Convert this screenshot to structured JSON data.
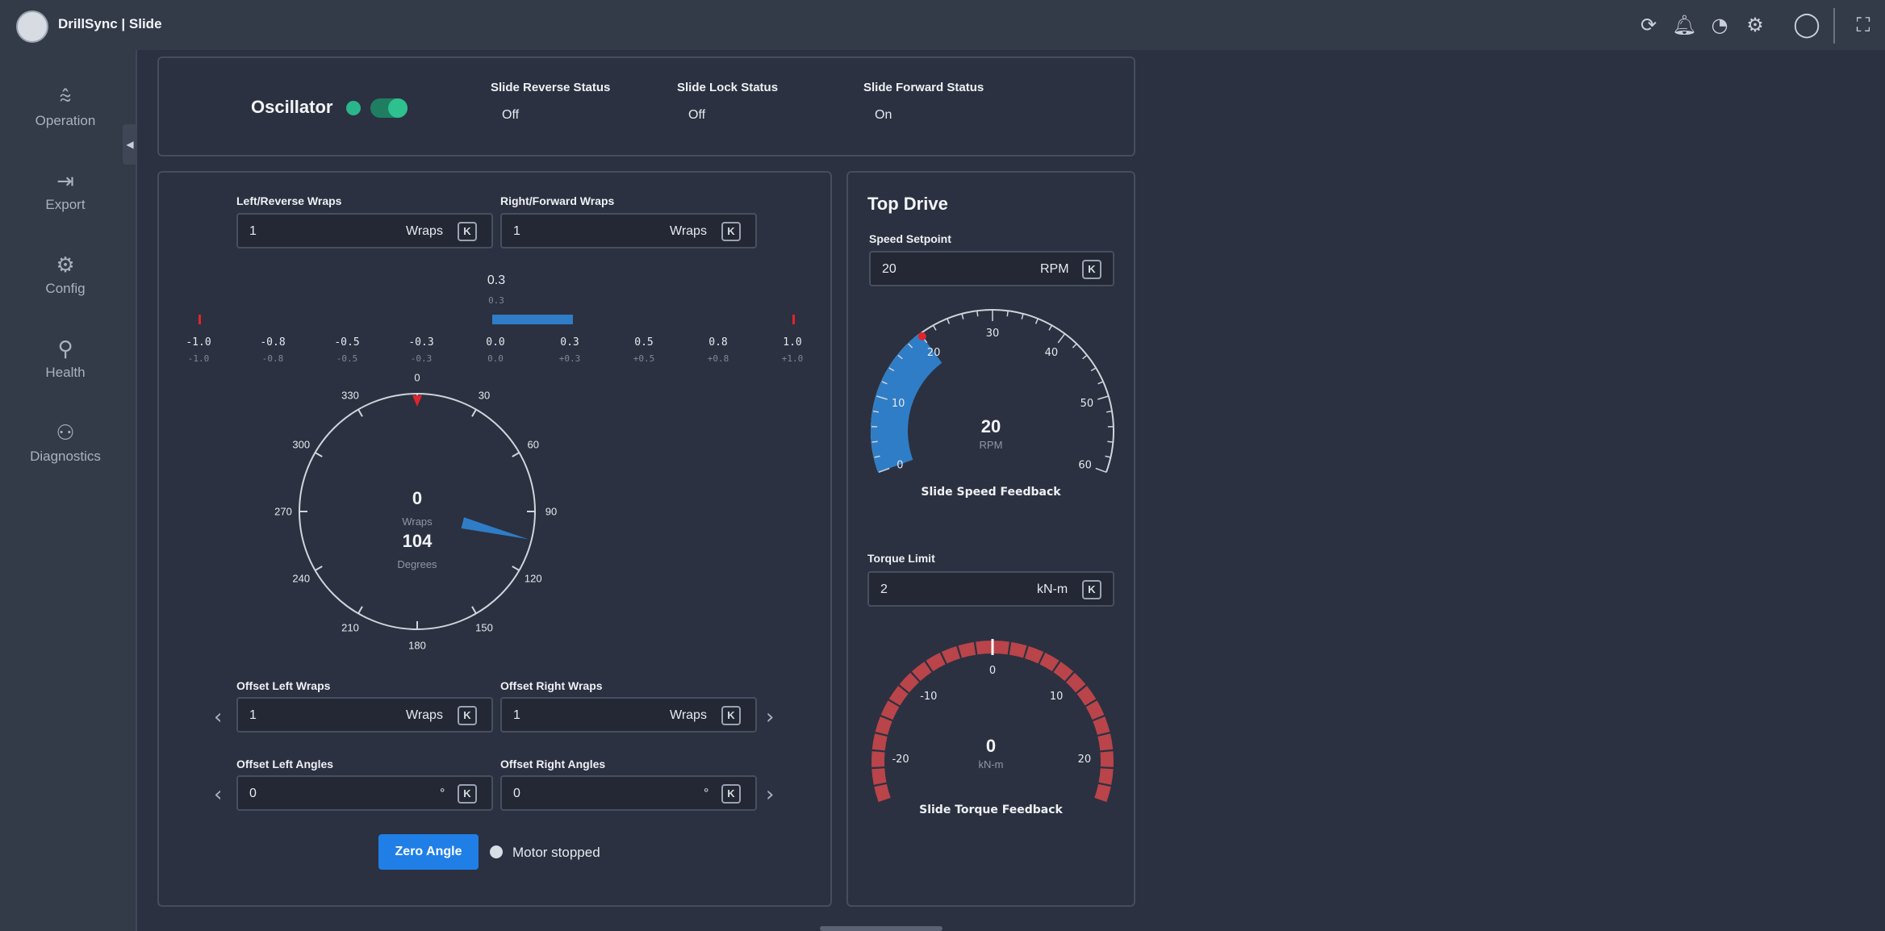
{
  "app": {
    "title": "DrillSync | Slide"
  },
  "topbar": {
    "icons": [
      "refresh-icon",
      "bell-icon",
      "gauge-icon",
      "gear-icon",
      "user-icon",
      "fullscreen-icon"
    ]
  },
  "sidebar": {
    "items": [
      {
        "label": "Operation",
        "icon": "operation-icon"
      },
      {
        "label": "Export",
        "icon": "export-icon"
      },
      {
        "label": "Config",
        "icon": "config-icon"
      },
      {
        "label": "Health",
        "icon": "health-icon"
      },
      {
        "label": "Diagnostics",
        "icon": "diagnostics-icon"
      }
    ]
  },
  "oscillator": {
    "title": "Oscillator",
    "enabled": true,
    "statuses": [
      {
        "label": "Slide Reverse Status",
        "value": "Off"
      },
      {
        "label": "Slide Lock Status",
        "value": "Off"
      },
      {
        "label": "Slide Forward Status",
        "value": "On"
      }
    ]
  },
  "wraps": {
    "left_label": "Left/Reverse Wraps",
    "left_value": "1",
    "right_label": "Right/Forward Wraps",
    "right_value": "1",
    "unit": "Wraps",
    "key": "K",
    "bar_value": "0.3",
    "bar_value_sub": "0.3",
    "bar_fraction": 0.3,
    "scale_labels": [
      "-1.0",
      "-0.8",
      "-0.5",
      "-0.3",
      "0.0",
      "0.3",
      "0.5",
      "0.8",
      "1.0"
    ],
    "scale_sub_labels": [
      "-1.0",
      "-0.8",
      "-0.5",
      "-0.3",
      "0.0",
      "+0.3",
      "+0.5",
      "+0.8",
      "+1.0"
    ],
    "dial": {
      "wraps_value": "0",
      "wraps_unit": "Wraps",
      "degrees_value": "104",
      "degrees_unit": "Degrees",
      "angle_deg": 104,
      "tick_labels": [
        "0",
        "30",
        "60",
        "90",
        "120",
        "150",
        "180",
        "210",
        "240",
        "270",
        "300",
        "330"
      ]
    },
    "offset_left_wraps_label": "Offset Left Wraps",
    "offset_left_wraps_value": "1",
    "offset_right_wraps_label": "Offset Right Wraps",
    "offset_right_wraps_value": "1",
    "offset_left_angles_label": "Offset Left Angles",
    "offset_left_angles_value": "0",
    "offset_right_angles_label": "Offset Right Angles",
    "offset_right_angles_value": "0",
    "angle_unit": "°",
    "zero_button": "Zero Angle",
    "motor_status": "Motor stopped"
  },
  "top_drive": {
    "title": "Top Drive",
    "speed_label": "Speed Setpoint",
    "speed_value": "20",
    "speed_unit": "RPM",
    "torque_label": "Torque Limit",
    "torque_value": "2",
    "torque_unit": "kN-m",
    "key": "K",
    "speed_gauge": {
      "value": "20",
      "unit": "RPM",
      "caption": "Slide Speed Feedback",
      "numeric_value": 20,
      "min": 0,
      "max": 60,
      "tick_labels": [
        "0",
        "10",
        "20",
        "30",
        "40",
        "50",
        "60"
      ]
    },
    "torque_gauge": {
      "value": "0",
      "unit": "kN-m",
      "caption": "Slide Torque Feedback",
      "numeric_value": 0,
      "min": -25,
      "max": 25,
      "tick_labels": [
        "-20",
        "-10",
        "0",
        "10",
        "20"
      ]
    }
  },
  "colors": {
    "accent_blue": "#2f7dc6",
    "button_blue": "#1f7fe6",
    "toggle_green": "#2ec08f",
    "torque_red": "#b9444a",
    "marker_red": "#e0242c"
  }
}
